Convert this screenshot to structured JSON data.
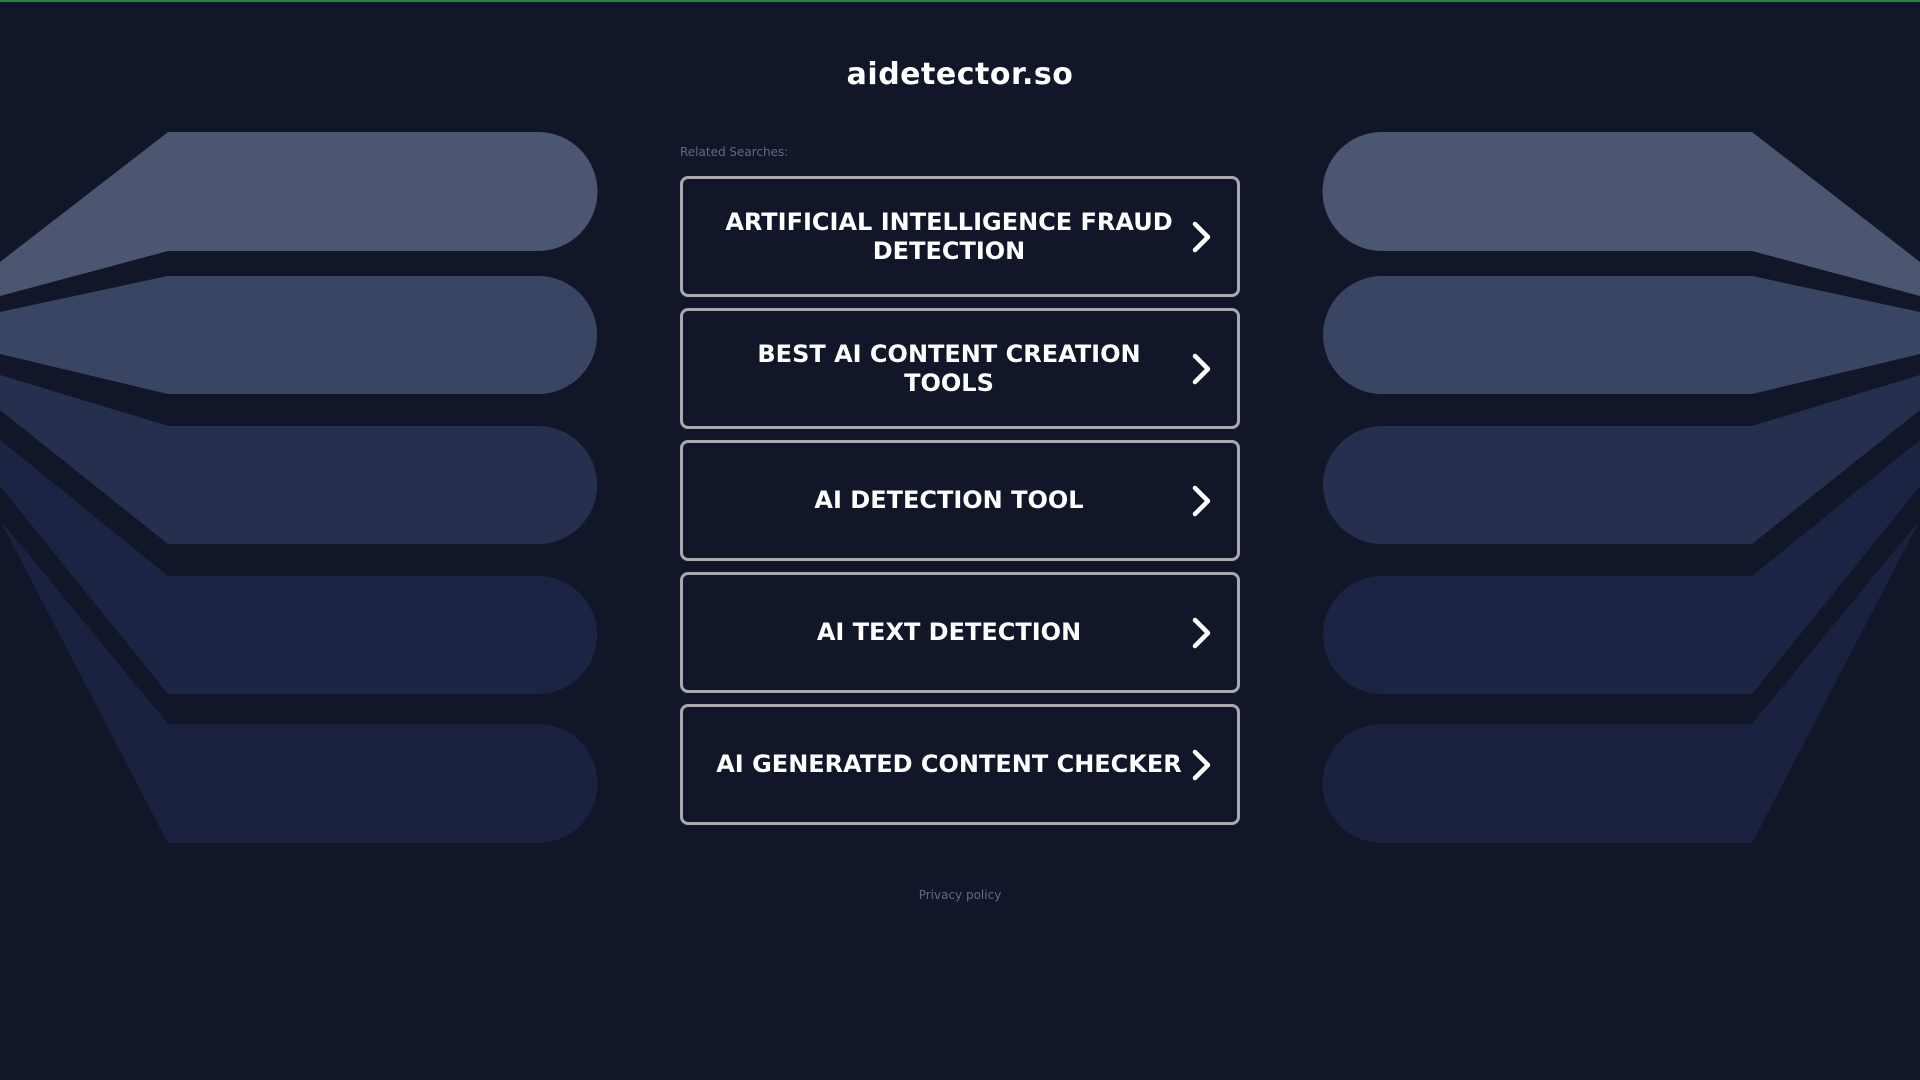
{
  "site": {
    "domain": "aidetector.so"
  },
  "related": {
    "label": "Related Searches:",
    "items": [
      {
        "label": "ARTIFICIAL INTELLIGENCE FRAUD DETECTION"
      },
      {
        "label": "BEST AI CONTENT CREATION TOOLS"
      },
      {
        "label": "AI DETECTION TOOL"
      },
      {
        "label": "AI TEXT DETECTION"
      },
      {
        "label": "AI GENERATED CONTENT CHECKER"
      }
    ]
  },
  "footer": {
    "privacy_label": "Privacy policy"
  },
  "icons": {
    "link_arrow": "chevron-right-icon"
  },
  "colors": {
    "background": "#111729",
    "accent_top_line": "#1f8a3a",
    "box_border": "#a9a9ad",
    "stripe_1": "#4d5670",
    "stripe_2": "#3a4463",
    "stripe_3": "#262f4d",
    "stripe_4": "#1c2443",
    "stripe_5": "#1a2240"
  }
}
